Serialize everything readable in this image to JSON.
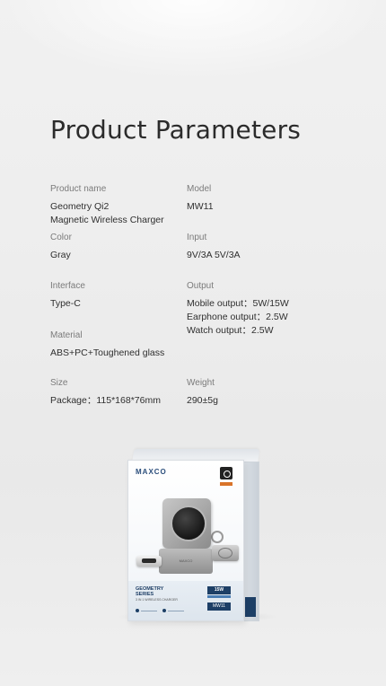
{
  "page": {
    "title": "Product Parameters"
  },
  "params": {
    "product_name": {
      "label": "Product name",
      "lines": [
        "Geometry Qi2",
        "Magnetic Wireless Charger"
      ]
    },
    "model": {
      "label": "Model",
      "value": "MW11"
    },
    "color": {
      "label": "Color",
      "value": "Gray"
    },
    "input": {
      "label": "Input",
      "value": "9V/3A  5V/3A"
    },
    "interface": {
      "label": "Interface",
      "value": "Type-C"
    },
    "output": {
      "label": "Output",
      "lines": [
        "Mobile output：5W/15W",
        "Earphone output：2.5W",
        "Watch output：2.5W"
      ]
    },
    "material": {
      "label": "Material",
      "value": "ABS+PC+Toughened glass"
    },
    "size": {
      "label": "Size",
      "value": "Package：115*168*76mm"
    },
    "weight": {
      "label": "Weight",
      "value": "290±5g"
    }
  },
  "product_box": {
    "brand": "MAXCO",
    "series_line1": "GEOMETRY",
    "series_line2": "SERIES",
    "series_sub": "3 IN 1 WIRELESS CHARGER",
    "watt": "15W",
    "model": "MW11",
    "base_text": "MAXCO"
  },
  "colors": {
    "accent_navy": "#1d3f66",
    "accent_orange": "#d9742a",
    "background": "#ededed"
  }
}
